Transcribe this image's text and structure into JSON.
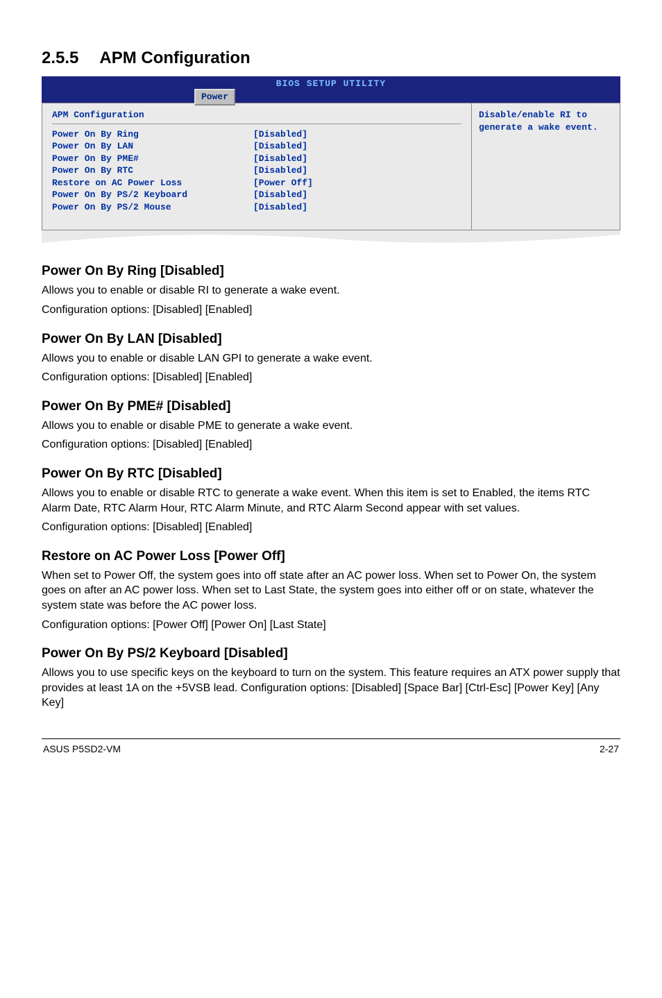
{
  "section": {
    "number": "2.5.5",
    "title": "APM Configuration"
  },
  "bios": {
    "header_title": "BIOS SETUP UTILITY",
    "tab": "Power",
    "panel_title": "APM Configuration",
    "help_text": "Disable/enable RI to generate a wake event.",
    "rows": [
      {
        "label": "Power On By Ring",
        "value": "[Disabled]"
      },
      {
        "label": "Power On By LAN",
        "value": "[Disabled]"
      },
      {
        "label": "Power On By PME#",
        "value": "[Disabled]"
      },
      {
        "label": "Power On By RTC",
        "value": "[Disabled]"
      },
      {
        "label": "Restore on AC Power Loss",
        "value": "[Power Off]"
      },
      {
        "label": "Power On By PS/2 Keyboard",
        "value": "[Disabled]"
      },
      {
        "label": "Power On By PS/2 Mouse",
        "value": "[Disabled]"
      }
    ]
  },
  "subsections": [
    {
      "heading": "Power On By Ring [Disabled]",
      "paras": [
        "Allows you to enable or disable RI to generate a wake event.",
        "Configuration options: [Disabled] [Enabled]"
      ]
    },
    {
      "heading": "Power On By LAN [Disabled]",
      "paras": [
        "Allows you to enable or disable LAN GPI to generate a wake event.",
        "Configuration options: [Disabled] [Enabled]"
      ]
    },
    {
      "heading": "Power On By PME# [Disabled]",
      "paras": [
        "Allows you to enable or disable PME to generate a wake event.",
        "Configuration options: [Disabled] [Enabled]"
      ]
    },
    {
      "heading": "Power On By RTC [Disabled]",
      "paras": [
        "Allows you to enable or disable RTC to generate a wake event. When this item is set to Enabled, the items RTC Alarm Date, RTC Alarm Hour, RTC Alarm Minute, and RTC Alarm Second appear with set values.",
        "Configuration options: [Disabled] [Enabled]"
      ]
    },
    {
      "heading": "Restore on AC Power Loss [Power Off]",
      "paras": [
        "When set to Power Off, the system goes into off state after an AC power loss. When set to Power On, the system goes on after an AC power loss. When set to Last State, the system goes into either off or on state, whatever the system state was before the AC power loss.",
        "Configuration options: [Power Off] [Power On] [Last State]"
      ]
    },
    {
      "heading": "Power On By PS/2 Keyboard [Disabled]",
      "paras": [
        "Allows you to use specific keys on the keyboard to turn on the system. This feature requires an ATX power supply that provides at least 1A on the +5VSB lead. Configuration options: [Disabled] [Space Bar] [Ctrl-Esc] [Power Key] [Any Key]"
      ]
    }
  ],
  "footer": {
    "left": "ASUS P5SD2-VM",
    "right": "2-27"
  }
}
